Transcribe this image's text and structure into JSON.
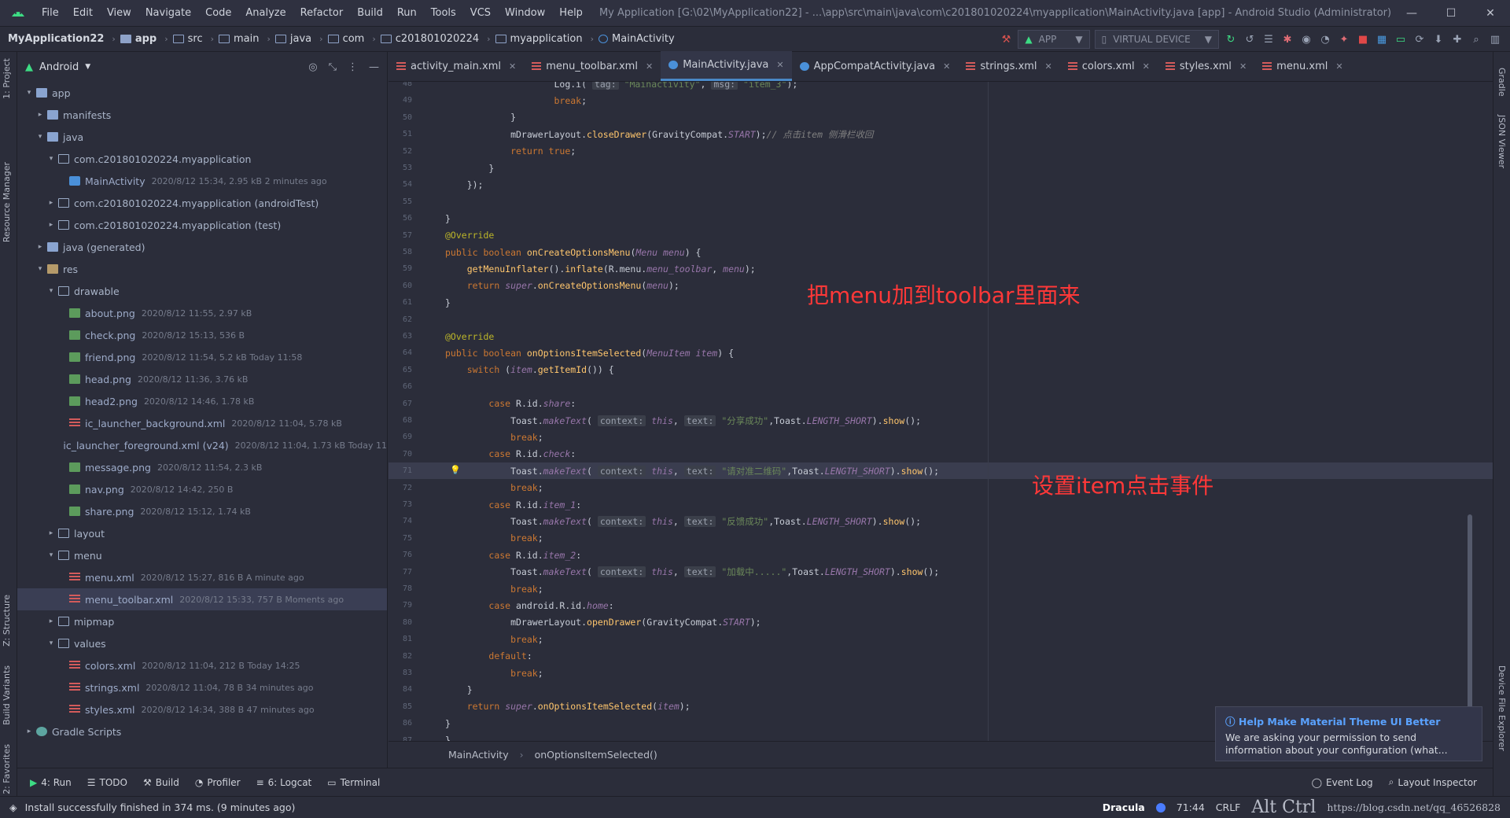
{
  "window": {
    "menu": [
      "File",
      "Edit",
      "View",
      "Navigate",
      "Code",
      "Analyze",
      "Refactor",
      "Build",
      "Run",
      "Tools",
      "VCS",
      "Window",
      "Help"
    ],
    "title": "My Application [G:\\02\\MyApplication22] - ...\\app\\src\\main\\java\\com\\c201801020224\\myapplication\\MainActivity.java [app] - Android Studio (Administrator)",
    "controls": [
      "—",
      "☐",
      "✕"
    ]
  },
  "navbar": {
    "project": "MyApplication22",
    "crumbs": [
      "app",
      "src",
      "main",
      "java",
      "com",
      "c201801020224",
      "myapplication",
      "MainActivity"
    ],
    "run_config": "APP",
    "device": "VIRTUAL DEVICE"
  },
  "side_tabs": {
    "left": [
      "1: Project",
      "Resource Manager",
      "Z: Structure",
      "Build Variants",
      "2: Favorites"
    ],
    "right": [
      "Gradle",
      "JSON Viewer",
      "Device File Explorer"
    ]
  },
  "project_panel": {
    "view": "Android",
    "tree": [
      {
        "d": 0,
        "arrow": "▾",
        "ic": "foldfill",
        "name": "app",
        "meta": ""
      },
      {
        "d": 1,
        "arrow": "▸",
        "ic": "foldfill",
        "name": "manifests",
        "meta": ""
      },
      {
        "d": 1,
        "arrow": "▾",
        "ic": "foldfill",
        "name": "java",
        "meta": ""
      },
      {
        "d": 2,
        "arrow": "▾",
        "ic": "fold",
        "name": "com.c201801020224.myapplication",
        "meta": ""
      },
      {
        "d": 3,
        "arrow": "",
        "ic": "java",
        "name": "MainActivity",
        "meta": "2020/8/12 15:34, 2.95 kB 2 minutes ago"
      },
      {
        "d": 2,
        "arrow": "▸",
        "ic": "fold",
        "name": "com.c201801020224.myapplication (androidTest)",
        "meta": ""
      },
      {
        "d": 2,
        "arrow": "▸",
        "ic": "fold",
        "name": "com.c201801020224.myapplication (test)",
        "meta": ""
      },
      {
        "d": 1,
        "arrow": "▸",
        "ic": "foldfill",
        "name": "java (generated)",
        "meta": ""
      },
      {
        "d": 1,
        "arrow": "▾",
        "ic": "res",
        "name": "res",
        "meta": ""
      },
      {
        "d": 2,
        "arrow": "▾",
        "ic": "fold",
        "name": "drawable",
        "meta": ""
      },
      {
        "d": 3,
        "arrow": "",
        "ic": "png",
        "name": "about.png",
        "meta": "2020/8/12 11:55, 2.97 kB"
      },
      {
        "d": 3,
        "arrow": "",
        "ic": "png",
        "name": "check.png",
        "meta": "2020/8/12 15:13, 536 B"
      },
      {
        "d": 3,
        "arrow": "",
        "ic": "png",
        "name": "friend.png",
        "meta": "2020/8/12 11:54, 5.2 kB Today 11:58"
      },
      {
        "d": 3,
        "arrow": "",
        "ic": "png",
        "name": "head.png",
        "meta": "2020/8/12 11:36, 3.76 kB"
      },
      {
        "d": 3,
        "arrow": "",
        "ic": "png",
        "name": "head2.png",
        "meta": "2020/8/12 14:46, 1.78 kB"
      },
      {
        "d": 3,
        "arrow": "",
        "ic": "xml",
        "name": "ic_launcher_background.xml",
        "meta": "2020/8/12 11:04, 5.78 kB"
      },
      {
        "d": 3,
        "arrow": "",
        "ic": "xml",
        "name": "ic_launcher_foreground.xml (v24)",
        "meta": "2020/8/12 11:04, 1.73 kB Today 11"
      },
      {
        "d": 3,
        "arrow": "",
        "ic": "png",
        "name": "message.png",
        "meta": "2020/8/12 11:54, 2.3 kB"
      },
      {
        "d": 3,
        "arrow": "",
        "ic": "png",
        "name": "nav.png",
        "meta": "2020/8/12 14:42, 250 B"
      },
      {
        "d": 3,
        "arrow": "",
        "ic": "png",
        "name": "share.png",
        "meta": "2020/8/12 15:12, 1.74 kB"
      },
      {
        "d": 2,
        "arrow": "▸",
        "ic": "fold",
        "name": "layout",
        "meta": ""
      },
      {
        "d": 2,
        "arrow": "▾",
        "ic": "fold",
        "name": "menu",
        "meta": ""
      },
      {
        "d": 3,
        "arrow": "",
        "ic": "xml",
        "name": "menu.xml",
        "meta": "2020/8/12 15:27, 816 B A minute ago"
      },
      {
        "d": 3,
        "arrow": "",
        "ic": "xml",
        "name": "menu_toolbar.xml",
        "meta": "2020/8/12 15:33, 757 B Moments ago",
        "sel": true
      },
      {
        "d": 2,
        "arrow": "▸",
        "ic": "fold",
        "name": "mipmap",
        "meta": ""
      },
      {
        "d": 2,
        "arrow": "▾",
        "ic": "fold",
        "name": "values",
        "meta": ""
      },
      {
        "d": 3,
        "arrow": "",
        "ic": "xml",
        "name": "colors.xml",
        "meta": "2020/8/12 11:04, 212 B Today 14:25"
      },
      {
        "d": 3,
        "arrow": "",
        "ic": "xml",
        "name": "strings.xml",
        "meta": "2020/8/12 11:04, 78 B 34 minutes ago"
      },
      {
        "d": 3,
        "arrow": "",
        "ic": "xml",
        "name": "styles.xml",
        "meta": "2020/8/12 14:34, 388 B 47 minutes ago"
      },
      {
        "d": 0,
        "arrow": "▸",
        "ic": "gradle",
        "name": "Gradle Scripts",
        "meta": ""
      }
    ]
  },
  "tabs": [
    {
      "name": "activity_main.xml",
      "type": "xml"
    },
    {
      "name": "menu_toolbar.xml",
      "type": "xml"
    },
    {
      "name": "MainActivity.java",
      "type": "java",
      "active": true
    },
    {
      "name": "AppCompatActivity.java",
      "type": "java"
    },
    {
      "name": "strings.xml",
      "type": "xml"
    },
    {
      "name": "colors.xml",
      "type": "xml"
    },
    {
      "name": "styles.xml",
      "type": "xml"
    },
    {
      "name": "menu.xml",
      "type": "xml"
    }
  ],
  "code_lines": [
    {
      "n": "48",
      "html": "                    Log.i( <span class='hint'>tag:</span> <span class='str'>\"Mainactivity\"</span>, <span class='hint'>msg:</span> <span class='str'>\"item_3\"</span>);"
    },
    {
      "n": "49",
      "html": "                    <span class='kw'>break</span>;"
    },
    {
      "n": "50",
      "html": "            }"
    },
    {
      "n": "51",
      "html": "            mDrawerLayout.<span class='fn'>closeDrawer</span>(GravityCompat.<span class='it'>START</span>);<span class='cm'>// 点击item 侧滑栏收回</span>"
    },
    {
      "n": "52",
      "html": "            <span class='kw'>return true</span>;"
    },
    {
      "n": "53",
      "html": "        }"
    },
    {
      "n": "54",
      "html": "    });"
    },
    {
      "n": "55",
      "html": ""
    },
    {
      "n": "56",
      "html": "}"
    },
    {
      "n": "57",
      "html": "<span class='an'>@Override</span>"
    },
    {
      "n": "58",
      "html": "<span class='kw'>public boolean</span> <span class='fn'>onCreateOptionsMenu</span>(<span class='it'>Menu menu</span>) {"
    },
    {
      "n": "59",
      "html": "    <span class='fn'>getMenuInflater</span>().<span class='fn'>inflate</span>(R.menu.<span class='it'>menu_toolbar</span>, <span class='it'>menu</span>);"
    },
    {
      "n": "60",
      "html": "    <span class='kw'>return</span> <span class='it'>super</span>.<span class='fn'>onCreateOptionsMenu</span>(<span class='it'>menu</span>);"
    },
    {
      "n": "61",
      "html": "}"
    },
    {
      "n": "62",
      "html": ""
    },
    {
      "n": "63",
      "html": "<span class='an'>@Override</span>"
    },
    {
      "n": "64",
      "html": "<span class='kw'>public boolean</span> <span class='fn'>onOptionsItemSelected</span>(<span class='it'>MenuItem item</span>) {"
    },
    {
      "n": "65",
      "html": "    <span class='kw'>switch</span> (<span class='it'>item</span>.<span class='fn'>getItemId</span>()) {"
    },
    {
      "n": "66",
      "html": ""
    },
    {
      "n": "67",
      "html": "        <span class='kw'>case</span> R.id.<span class='it'>share</span>:"
    },
    {
      "n": "68",
      "html": "            Toast.<span class='it'>makeText</span>( <span class='hint'>context:</span> <span class='it'>this</span>, <span class='hint'>text:</span> <span class='str'>\"分享成功\"</span>,Toast.<span class='it'>LENGTH_SHORT</span>).<span class='fn'>show</span>();"
    },
    {
      "n": "69",
      "html": "            <span class='kw'>break</span>;"
    },
    {
      "n": "70",
      "html": "        <span class='kw'>case</span> R.id.<span class='it'>check</span>:"
    },
    {
      "n": "71",
      "html": "            Toast.<span class='it'>makeText</span>( <span class='hint'>context:</span> <span class='it'>this</span>, <span class='hint'>text:</span> <span class='str'>\"请对准二维码\"</span>,Toast.<span class='it'>LENGTH_SHORT</span>).<span class='fn'>show</span>();",
      "hl": true
    },
    {
      "n": "72",
      "html": "            <span class='kw'>break</span>;"
    },
    {
      "n": "73",
      "html": "        <span class='kw'>case</span> R.id.<span class='it'>item_1</span>:"
    },
    {
      "n": "74",
      "html": "            Toast.<span class='it'>makeText</span>( <span class='hint'>context:</span> <span class='it'>this</span>, <span class='hint'>text:</span> <span class='str'>\"反馈成功\"</span>,Toast.<span class='it'>LENGTH_SHORT</span>).<span class='fn'>show</span>();"
    },
    {
      "n": "75",
      "html": "            <span class='kw'>break</span>;"
    },
    {
      "n": "76",
      "html": "        <span class='kw'>case</span> R.id.<span class='it'>item_2</span>:"
    },
    {
      "n": "77",
      "html": "            Toast.<span class='it'>makeText</span>( <span class='hint'>context:</span> <span class='it'>this</span>, <span class='hint'>text:</span> <span class='str'>\"加载中.....\"</span>,Toast.<span class='it'>LENGTH_SHORT</span>).<span class='fn'>show</span>();"
    },
    {
      "n": "78",
      "html": "            <span class='kw'>break</span>;"
    },
    {
      "n": "79",
      "html": "        <span class='kw'>case</span> android.R.id.<span class='it'>home</span>:"
    },
    {
      "n": "80",
      "html": "            mDrawerLayout.<span class='fn'>openDrawer</span>(GravityCompat.<span class='it'>START</span>);"
    },
    {
      "n": "81",
      "html": "            <span class='kw'>break</span>;"
    },
    {
      "n": "82",
      "html": "        <span class='kw'>default</span>:"
    },
    {
      "n": "83",
      "html": "            <span class='kw'>break</span>;"
    },
    {
      "n": "84",
      "html": "    }"
    },
    {
      "n": "85",
      "html": "    <span class='kw'>return</span> <span class='it'>super</span>.<span class='fn'>onOptionsItemSelected</span>(<span class='it'>item</span>);"
    },
    {
      "n": "86",
      "html": "}"
    },
    {
      "n": "87",
      "html": "}"
    }
  ],
  "annotations": [
    "把menu加到toolbar里面来",
    "设置item点击事件"
  ],
  "editor_breadcrumb": [
    "MainActivity",
    "onOptionsItemSelected()"
  ],
  "notification": {
    "title": "Help Make Material Theme UI Better",
    "body": "We are asking your permission to send information about your configuration (what..."
  },
  "toolwindows": {
    "left": [
      "4: Run",
      "TODO",
      "Build",
      "Profiler",
      "6: Logcat",
      "Terminal"
    ],
    "right": [
      "Event Log",
      "Layout Inspector"
    ]
  },
  "status": {
    "message": "Install successfully finished in 374 ms. (9 minutes ago)",
    "theme": "Dracula",
    "position": "71:44",
    "line_sep": "CRLF",
    "watermark": "https://blog.csdn.net/qq_46526828",
    "overlay": "Alt Ctrl"
  },
  "colors": {
    "accent": "#4a88c7",
    "annotation": "#ff3838",
    "link": "#5aa2ff"
  }
}
